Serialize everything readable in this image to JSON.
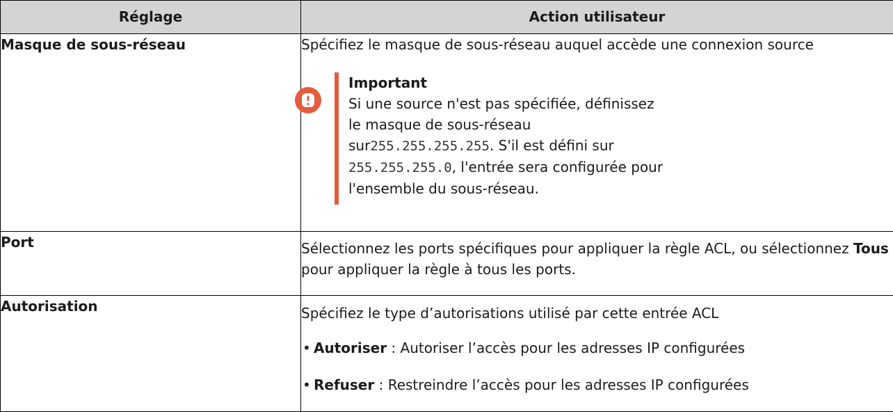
{
  "header": {
    "col1": "Réglage",
    "col2": "Action utilisateur"
  },
  "rows": [
    {
      "setting": "Masque de sous-réseau",
      "action": "Spécifiez le masque de sous-réseau auquel accède une connexion source",
      "note": {
        "icon": "exclamation-circle-icon",
        "title": "Important",
        "text_a": "Si une source n'est pas spécifiée, définissez le masque de sous-réseau sur",
        "code_a": "255.255.255.255",
        "text_b": ". S'il est défini sur ",
        "code_b": "255.255.255.0",
        "text_c": ", l'entrée sera configurée pour l'ensemble du sous-réseau."
      }
    },
    {
      "setting": "Port",
      "action_a": "Sélectionnez les ports spécifiques pour appliquer la règle ACL, ou sélectionnez ",
      "action_bold": "Tous",
      "action_b": " pour appliquer la règle à tous les ports."
    },
    {
      "setting": "Autorisation",
      "action": "Spécifiez le type d’autorisations utilisé par cette entrée ACL",
      "options": [
        {
          "label": "Autoriser",
          "text": " : Autoriser l’accès pour les adresses IP configurées"
        },
        {
          "label": "Refuser",
          "text": " : Restreindre l’accès pour les adresses IP configurées"
        }
      ]
    }
  ],
  "colors": {
    "header_bg": "#d4d4d4",
    "note_accent": "#e35c3c",
    "border": "#000000"
  }
}
